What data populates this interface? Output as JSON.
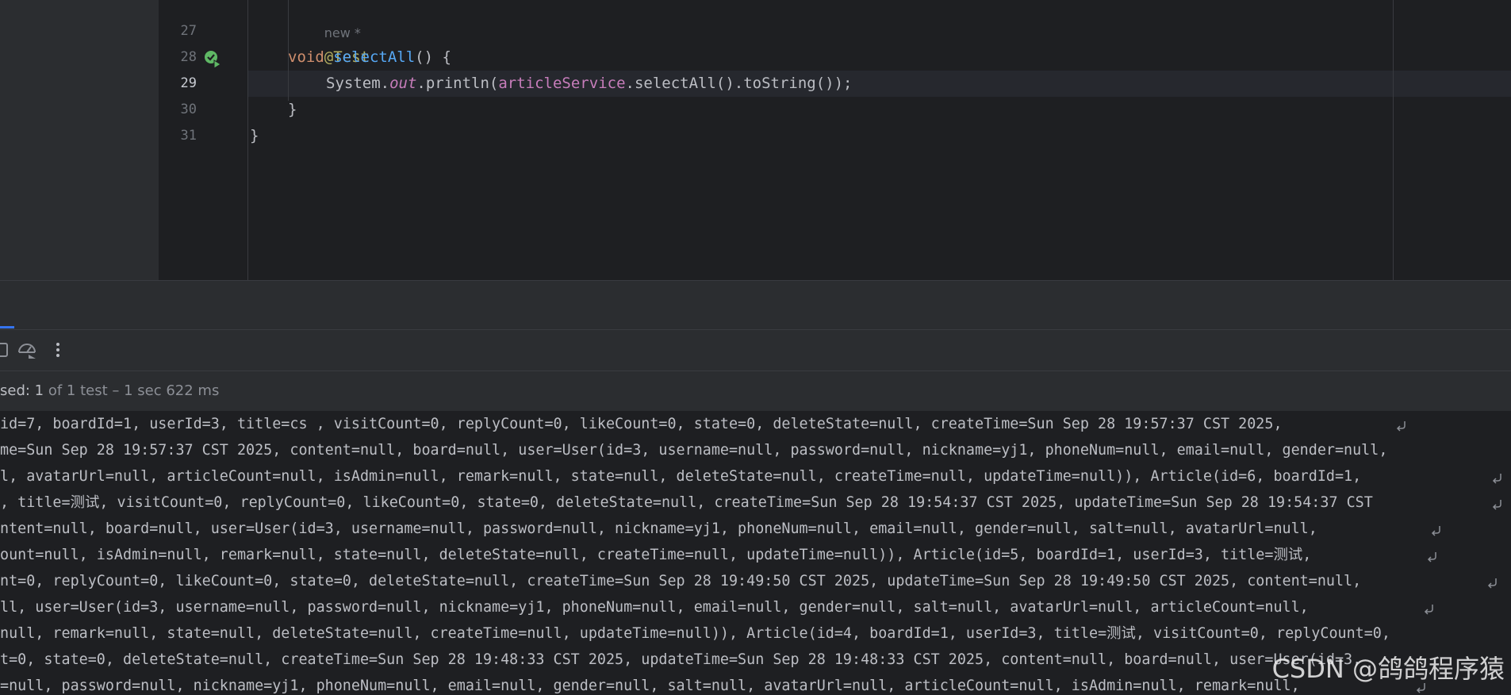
{
  "editor": {
    "inlay_hint": "new *",
    "lines": [
      {
        "num": "27",
        "annotation": "@Test"
      },
      {
        "num": "28",
        "keyword": "void",
        "method": "selectAll",
        "rest": "() {"
      },
      {
        "num": "29",
        "prefix": "System.",
        "static_field": "out",
        "mid": ".println(",
        "field": "articleService",
        "suffix": ".selectAll().toString());"
      },
      {
        "num": "30",
        "text": "}"
      },
      {
        "num": "31",
        "text": "}"
      }
    ]
  },
  "icons": {
    "run_gutter": "run-test-passed-icon",
    "toolbar": [
      "stop-icon",
      "coverage-icon",
      "more-options-icon"
    ],
    "soft_wrap": "soft-wrap-icon"
  },
  "status": {
    "label": "sed: 1",
    "detail": " of 1 test – 1 sec 622 ms"
  },
  "console": {
    "lines": [
      "id=7, boardId=1, userId=3, title=cs , visitCount=0, replyCount=0, likeCount=0, state=0, deleteState=null, createTime=Sun Sep 28 19:57:37 CST 2025, ",
      "me=Sun Sep 28 19:57:37 CST 2025, content=null, board=null, user=User(id=3, username=null, password=null, nickname=yj1, phoneNum=null, email=null, gender=null,",
      "l, avatarUrl=null, articleCount=null, isAdmin=null, remark=null, state=null, deleteState=null, createTime=null, updateTime=null)), Article(id=6, boardId=1, ",
      ", title=测试, visitCount=0, replyCount=0, likeCount=0, state=0, deleteState=null, createTime=Sun Sep 28 19:54:37 CST 2025, updateTime=Sun Sep 28 19:54:37 CST ",
      "ntent=null, board=null, user=User(id=3, username=null, password=null, nickname=yj1, phoneNum=null, email=null, gender=null, salt=null, avatarUrl=null, ",
      "ount=null, isAdmin=null, remark=null, state=null, deleteState=null, createTime=null, updateTime=null)), Article(id=5, boardId=1, userId=3, title=测试, ",
      "nt=0, replyCount=0, likeCount=0, state=0, deleteState=null, createTime=Sun Sep 28 19:49:50 CST 2025, updateTime=Sun Sep 28 19:49:50 CST 2025, content=null, ",
      "ll, user=User(id=3, username=null, password=null, nickname=yj1, phoneNum=null, email=null, gender=null, salt=null, avatarUrl=null, articleCount=null, ",
      "null, remark=null, state=null, deleteState=null, createTime=null, updateTime=null)), Article(id=4, boardId=1, userId=3, title=测试, visitCount=0, replyCount=0,",
      "t=0, state=0, deleteState=null, createTime=Sun Sep 28 19:48:33 CST 2025, updateTime=Sun Sep 28 19:48:33 CST 2025, content=null, board=null, user=User(id=3,",
      "=null, password=null, nickname=yj1, phoneNum=null, email=null, gender=null, salt=null, avatarUrl=null, articleCount=null, isAdmin=null, remark=null, "
    ]
  },
  "watermark": "CSDN @鸽鸽程序猿",
  "colors": {
    "background": "#1e1f22",
    "panel": "#2b2d30",
    "annotation": "#b3ae60",
    "keyword": "#cf8e6d",
    "method": "#56a8f5",
    "field": "#c77dbb",
    "accent": "#3574f0",
    "pass": "#5fb865"
  }
}
